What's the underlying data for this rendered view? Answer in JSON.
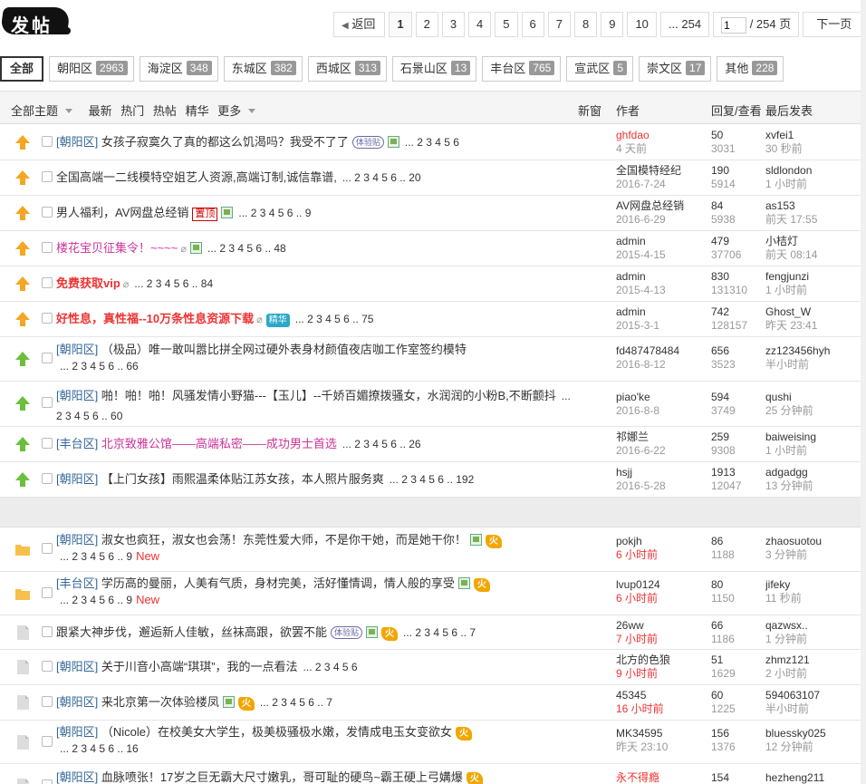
{
  "post_button": "发帖",
  "pager": {
    "prev": "返回",
    "pages": [
      "1",
      "2",
      "3",
      "4",
      "5",
      "6",
      "7",
      "8",
      "9",
      "10"
    ],
    "last": "... 254",
    "input_value": "1",
    "total": "/ 254 页",
    "next": "下一页"
  },
  "tabs": [
    {
      "label": "全部",
      "count": ""
    },
    {
      "label": "朝阳区",
      "count": "2963"
    },
    {
      "label": "海淀区",
      "count": "348"
    },
    {
      "label": "东城区",
      "count": "382"
    },
    {
      "label": "西城区",
      "count": "313"
    },
    {
      "label": "石景山区",
      "count": "13"
    },
    {
      "label": "丰台区",
      "count": "765"
    },
    {
      "label": "宣武区",
      "count": "5"
    },
    {
      "label": "崇文区",
      "count": "17"
    },
    {
      "label": "其他",
      "count": "228"
    }
  ],
  "header": {
    "all_topics": "全部主题",
    "latest": "最新",
    "hot": "热门",
    "hot_posts": "热帖",
    "digest": "精华",
    "more": "更多",
    "new_window": "新窗",
    "author": "作者",
    "replies_views": "回复/查看",
    "last_post": "最后发表"
  },
  "rows": [
    {
      "cat": "[朝阳区]",
      "title": "女孩子寂寞久了真的都这么饥渴吗？我受不了了",
      "pages": "... 2 3 4 5 6",
      "author": "ghfdao",
      "date": "4 天前",
      "replies": "50",
      "views": "3031",
      "last_user": "xvfei1",
      "last_time": "30 秒前"
    },
    {
      "cat": "",
      "title": "全国高端一二线模特空姐艺人资源,高端订制,诚信靠谱,",
      "pages": "... 2 3 4 5 6 .. 20",
      "author": "全国模特经纪",
      "date": "2016-7-24",
      "replies": "190",
      "views": "5914",
      "last_user": "sldlondon",
      "last_time": "1 小时前"
    },
    {
      "cat": "",
      "title": "男人福利，AV网盘总经销",
      "pages": "... 2 3 4 5 6 .. 9",
      "author": "AV网盘总经销",
      "date": "2016-6-29",
      "replies": "84",
      "views": "5938",
      "last_user": "as153",
      "last_time": "前天 17:55"
    },
    {
      "cat": "",
      "title": "楼花宝贝征集令！~~~~",
      "pages": "... 2 3 4 5 6 .. 48",
      "author": "admin",
      "date": "2015-4-15",
      "replies": "479",
      "views": "37706",
      "last_user": "小桔灯",
      "last_time": "前天 08:14"
    },
    {
      "cat": "",
      "title": "免费获取vip",
      "pages": "... 2 3 4 5 6 .. 84",
      "author": "admin",
      "date": "2015-4-13",
      "replies": "830",
      "views": "131310",
      "last_user": "fengjunzi",
      "last_time": "1 小时前"
    },
    {
      "cat": "",
      "title": "好性息，真性福--10万条性息资源下载",
      "pages": "... 2 3 4 5 6 .. 75",
      "author": "admin",
      "date": "2015-3-1",
      "replies": "742",
      "views": "128157",
      "last_user": "Ghost_W",
      "last_time": "昨天 23:41"
    },
    {
      "cat": "[朝阳区]",
      "title": "（极品）唯一敢叫嚣比拼全网过硬外表身材颜值夜店咖工作室签约模特",
      "pages": "... 2 3 4 5 6 .. 66",
      "author": "fd487478484",
      "date": "2016-8-12",
      "replies": "656",
      "views": "3523",
      "last_user": "zz123456hyh",
      "last_time": "半小时前"
    },
    {
      "cat": "[朝阳区]",
      "title": "啪！啪！啪！风骚发情小野猫---【玉儿】--千娇百媚撩拨骚女，水润润的小粉B,不断颤抖",
      "pages": "... 2 3 4 5 6 .. 60",
      "author": "piao'ke",
      "date": "2016-8-8",
      "replies": "594",
      "views": "3749",
      "last_user": "qushi",
      "last_time": "25 分钟前"
    },
    {
      "cat": "[丰台区]",
      "title": "北京致雅公馆——高端私密——成功男士首选",
      "pages": "... 2 3 4 5 6 .. 26",
      "author": "祁娜兰",
      "date": "2016-6-22",
      "replies": "259",
      "views": "9308",
      "last_user": "baiweising",
      "last_time": "1 小时前"
    },
    {
      "cat": "[朝阳区]",
      "title": "【上门女孩】雨熙温柔体贴江苏女孩，本人照片服务爽",
      "pages": "... 2 3 4 5 6 .. 192",
      "author": "hsjj",
      "date": "2016-5-28",
      "replies": "1913",
      "views": "12047",
      "last_user": "adgadgg",
      "last_time": "13 分钟前"
    },
    {
      "cat": "[朝阳区]",
      "title": "淑女也疯狂，淑女也会荡！东莞性爱大师，不是你干她，而是她干你！",
      "pages": "... 2 3 4 5 6 .. 9",
      "new": "New",
      "author": "pokjh",
      "date": "6 小时前",
      "replies": "86",
      "views": "1188",
      "last_user": "zhaosuotou",
      "last_time": "3 分钟前"
    },
    {
      "cat": "[丰台区]",
      "title": "学历高的曼丽，人美有气质，身材完美，活好懂情调，情人般的享受",
      "pages": "... 2 3 4 5 6 .. 9",
      "new": "New",
      "author": "lvup0124",
      "date": "6 小时前",
      "replies": "80",
      "views": "1150",
      "last_user": "jifeky",
      "last_time": "11 秒前"
    },
    {
      "cat": "",
      "title": "跟紧大神步伐，邂逅新人佳敏，丝袜高跟，欲罢不能",
      "pages": "... 2 3 4 5 6 .. 7",
      "author": "26ww",
      "date": "7 小时前",
      "replies": "66",
      "views": "1186",
      "last_user": "qazwsx..",
      "last_time": "1 分钟前"
    },
    {
      "cat": "[朝阳区]",
      "title": "关于川音小高端“琪琪”，我的一点看法",
      "pages": "... 2 3 4 5 6",
      "author": "北方的色狼",
      "date": "9 小时前",
      "replies": "51",
      "views": "1629",
      "last_user": "zhmz121",
      "last_time": "2 小时前"
    },
    {
      "cat": "[朝阳区]",
      "title": "来北京第一次体验楼凤",
      "pages": "... 2 3 4 5 6 .. 7",
      "author": "45345",
      "date": "16 小时前",
      "replies": "60",
      "views": "1225",
      "last_user": "594063107",
      "last_time": "半小时前"
    },
    {
      "cat": "[朝阳区]",
      "title": "（Nicole）在校美女大学生，极美极骚极水嫩，发情成电玉女变欲女",
      "pages": "... 2 3 4 5 6 .. 16",
      "author": "MK34595",
      "date": "昨天 23:10",
      "replies": "156",
      "views": "1376",
      "last_user": "bluessky025",
      "last_time": "12 分钟前"
    },
    {
      "cat": "[朝阳区]",
      "title": "血脉喷张！17岁之巨无霸大尺寸嫩乳，哥可耻的硬鸟~霸王硬上弓媾爆",
      "pages": "",
      "author": "永不得瘾",
      "date": "",
      "replies": "154",
      "views": "",
      "last_user": "hezheng211",
      "last_time": ""
    }
  ],
  "badges": {
    "trial": "体验贴",
    "hot": "火",
    "pinned": "置顶",
    "digest": "精华"
  },
  "colors": {
    "accent_red": "#e33333",
    "link_blue": "#336699",
    "pink_title": "#cc3399",
    "up_orange": "#f5a623",
    "up_green": "#6cbf3a"
  }
}
